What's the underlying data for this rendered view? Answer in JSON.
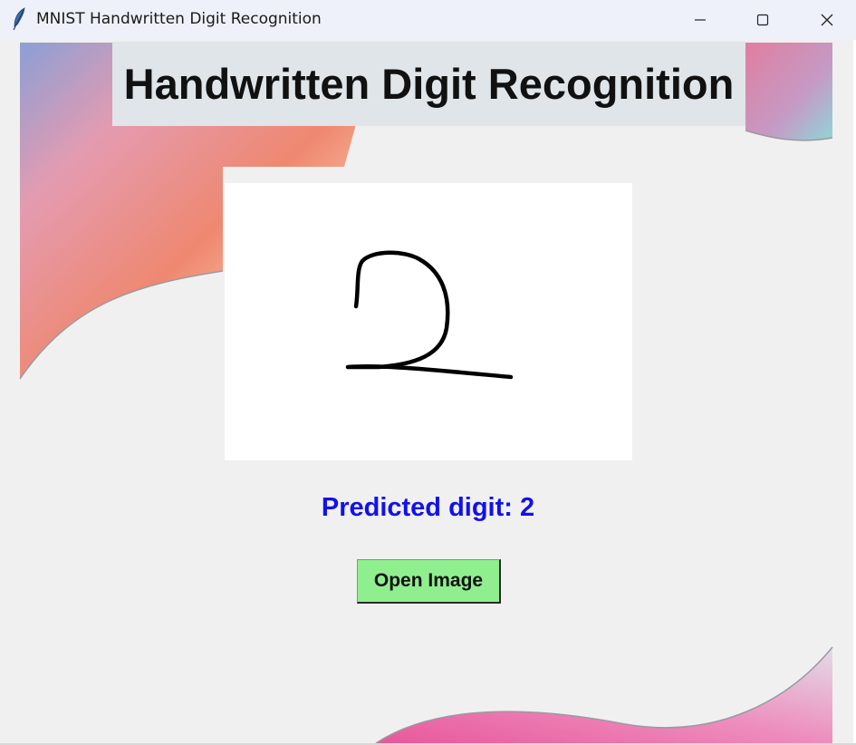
{
  "window": {
    "title": "MNIST Handwritten Digit Recognition",
    "icon": "feather-icon",
    "controls": [
      "minimize-icon",
      "maximize-icon",
      "close-icon"
    ]
  },
  "app": {
    "heading": "Handwritten Digit Recognition",
    "image": {
      "content": "handwritten-digit-2"
    },
    "prediction_text": "Predicted digit: 2",
    "open_button_label": "Open Image"
  },
  "colors": {
    "client_background": "#f0f0f0",
    "heading_background": "#dfe5e8",
    "prediction_text": "#1111ee",
    "button_background": "#8fef8f"
  }
}
